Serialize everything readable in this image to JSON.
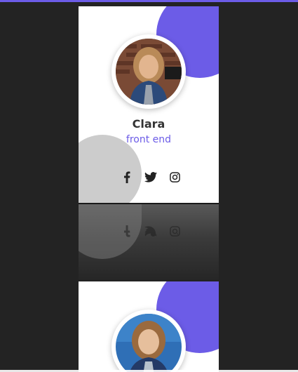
{
  "cards": [
    {
      "name": "Clara",
      "role": "front end",
      "social": [
        "facebook-icon",
        "twitter-icon",
        "instagram-icon"
      ]
    },
    {
      "name": "",
      "role": ""
    }
  ],
  "colors": {
    "accent": "#6c5ce7",
    "background": "#232323",
    "card": "#ffffff",
    "deco_gray": "#cccccc",
    "name_text": "#333333"
  }
}
